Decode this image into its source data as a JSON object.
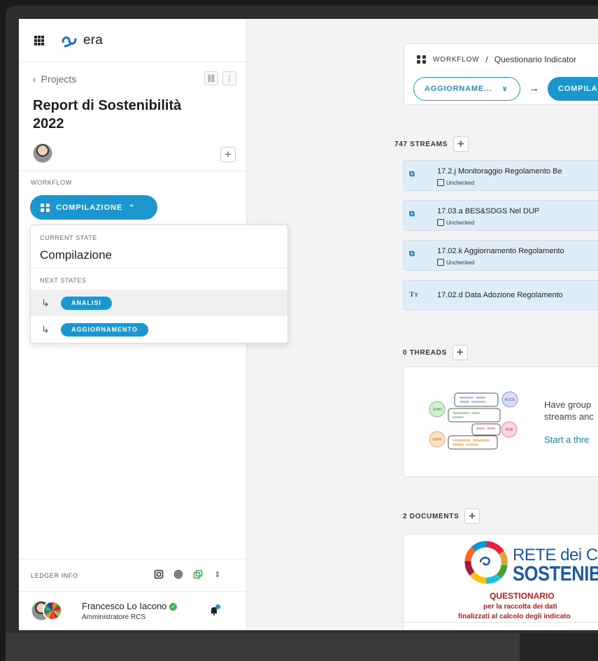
{
  "app": {
    "brand": "era"
  },
  "sidebar": {
    "back_label": "Projects",
    "project_title": "Report di Sostenibilità 2022",
    "workflow_label": "WORKFLOW",
    "workflow_state_button": "COMPILAZIONE",
    "dropdown": {
      "current_state_label": "CURRENT STATE",
      "current_state_value": "Compilazione",
      "next_states_label": "NEXT STATES",
      "next_states": [
        "ANALISI",
        "AGGIORNAMENTO"
      ]
    },
    "ledger_label": "LEDGER INFO",
    "user": {
      "name": "Francesco Lo Iacono",
      "role": "Amministratore RCS"
    }
  },
  "main": {
    "workflow_card": {
      "crumb_prefix": "WORKFLOW",
      "crumb_separator": "/",
      "crumb_name": "Questionario Indicator",
      "state_select": "AGGIORNAME...",
      "arrow": "→",
      "next_state": "COMPILA"
    },
    "streams": {
      "label": "747 STREAMS",
      "items": [
        {
          "title": "17.2.j Monitoraggio Regolamento Be",
          "status": "Unchecked",
          "icon": "stream-link-icon"
        },
        {
          "title": "17.03.a BES&SDGS Nel DUP",
          "status": "Unchecked",
          "icon": "stream-link-icon"
        },
        {
          "title": "17.02.k Aggiornamento Regolamento",
          "status": "Unchecked",
          "icon": "stream-link-icon"
        },
        {
          "title": "17.02.d Data Adozione Regolamento",
          "status": "",
          "icon": "text-type-icon"
        }
      ]
    },
    "threads": {
      "label": "0 THREADS",
      "illustration_names": [
        "JOHN",
        "ALICE",
        "BOB",
        "ERIN"
      ],
      "text_line1": "Have group",
      "text_line2": "streams anc",
      "link": "Start a thre"
    },
    "documents": {
      "label": "2 DOCUMENTS",
      "preview": {
        "line1": "RETE dei COMUN",
        "line2": "SOSTENIBII",
        "line3": "QUESTIONARIO",
        "line4": "per la raccolta dei dati",
        "line5": "finalizzati al calcolo degli indicato"
      }
    }
  },
  "colors": {
    "accent": "#1b96cf",
    "stream_bg": "#deedf8",
    "doc_red": "#cc1a1a",
    "doc_blue": "#1f5aa5"
  }
}
